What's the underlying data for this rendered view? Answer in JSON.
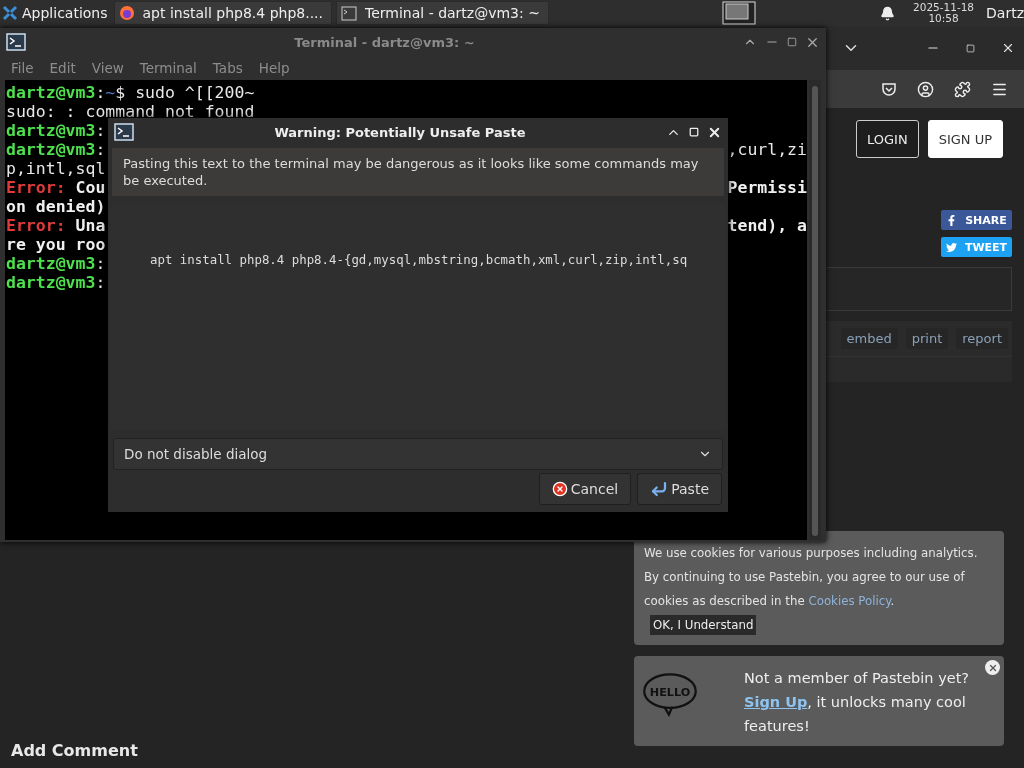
{
  "taskbar": {
    "apps_menu": "Applications",
    "tasks": [
      {
        "label": "apt install php8.4 php8....",
        "kind": "browser"
      },
      {
        "label": "Terminal - dartz@vm3: ~",
        "kind": "terminal"
      }
    ],
    "clock": {
      "date": "2025-11-18",
      "time": "10:58"
    },
    "user": "Dartz"
  },
  "browser": {
    "auth_buttons": [
      {
        "label": "LOGIN",
        "kind": "outline"
      },
      {
        "label": "SIGN UP",
        "kind": "filled"
      }
    ],
    "share_buttons": [
      {
        "label": "SHARE",
        "kind": "facebook"
      },
      {
        "label": "TWEET",
        "kind": "twitter"
      }
    ],
    "paste_actions": [
      "embed",
      "print",
      "report"
    ],
    "comment_heading": "Add Comment",
    "cookie_notice": {
      "text": "We use cookies for various purposes including analytics. By continuing to use Pastebin, you agree to our use of cookies as described in the",
      "link": "Cookies Policy",
      "after": ".",
      "button": "OK, I Understand"
    },
    "signup_notice": {
      "badge": "HELLO",
      "question": "Not a member of Pastebin yet?",
      "link": "Sign Up",
      "rest": ", it unlocks many cool features!"
    }
  },
  "terminal": {
    "title": "Terminal - dartz@vm3: ~",
    "menu": [
      "File",
      "Edit",
      "View",
      "Terminal",
      "Tabs",
      "Help"
    ],
    "lines": [
      {
        "left": [
          {
            "kind": "prompt",
            "text": "dartz@vm3"
          },
          {
            "kind": "plain",
            "text": ":"
          },
          {
            "kind": "path",
            "text": "~"
          },
          {
            "kind": "plain",
            "text": "$ sudo ^[[200~"
          }
        ]
      },
      {
        "left": [
          {
            "kind": "plain",
            "text": "sudo: : command not found"
          }
        ]
      },
      {
        "left": [
          {
            "kind": "prompt",
            "text": "dartz@vm3"
          },
          {
            "kind": "plain",
            "text": ":"
          }
        ]
      },
      {
        "left": [
          {
            "kind": "prompt",
            "text": "dartz@vm3"
          },
          {
            "kind": "plain",
            "text": ":"
          }
        ],
        "right": [
          {
            "kind": "plain",
            "text": ",curl,zi"
          }
        ]
      },
      {
        "left": [
          {
            "kind": "plain",
            "text": "p,intl,sql"
          }
        ]
      },
      {
        "left": [
          {
            "kind": "error",
            "text": "Error:"
          },
          {
            "kind": "bold",
            "text": " Cou"
          }
        ],
        "right": [
          {
            "kind": "bold",
            "text": "Permissi"
          }
        ]
      },
      {
        "left": [
          {
            "kind": "bold",
            "text": "on denied)"
          }
        ]
      },
      {
        "left": [
          {
            "kind": "error",
            "text": "Error:"
          },
          {
            "kind": "bold",
            "text": " Una"
          }
        ],
        "right": [
          {
            "kind": "bold",
            "text": "tend), a"
          }
        ]
      },
      {
        "left": [
          {
            "kind": "bold",
            "text": "re you roo"
          }
        ]
      },
      {
        "left": [
          {
            "kind": "prompt",
            "text": "dartz@vm3"
          },
          {
            "kind": "plain",
            "text": ":"
          }
        ]
      },
      {
        "left": [
          {
            "kind": "prompt",
            "text": "dartz@vm3"
          },
          {
            "kind": "plain",
            "text": ":"
          }
        ]
      }
    ]
  },
  "dialog": {
    "title": "Warning: Potentially Unsafe Paste",
    "message": "Pasting this text to the terminal may be dangerous as it looks like some commands may be executed.",
    "command": "apt install php8.4 php8.4-{gd,mysql,mbstring,bcmath,xml,curl,zip,intl,sq",
    "dropdown": "Do not disable dialog",
    "buttons": [
      {
        "label": "Cancel",
        "kind": "cancel"
      },
      {
        "label": "Paste",
        "kind": "paste"
      }
    ]
  }
}
